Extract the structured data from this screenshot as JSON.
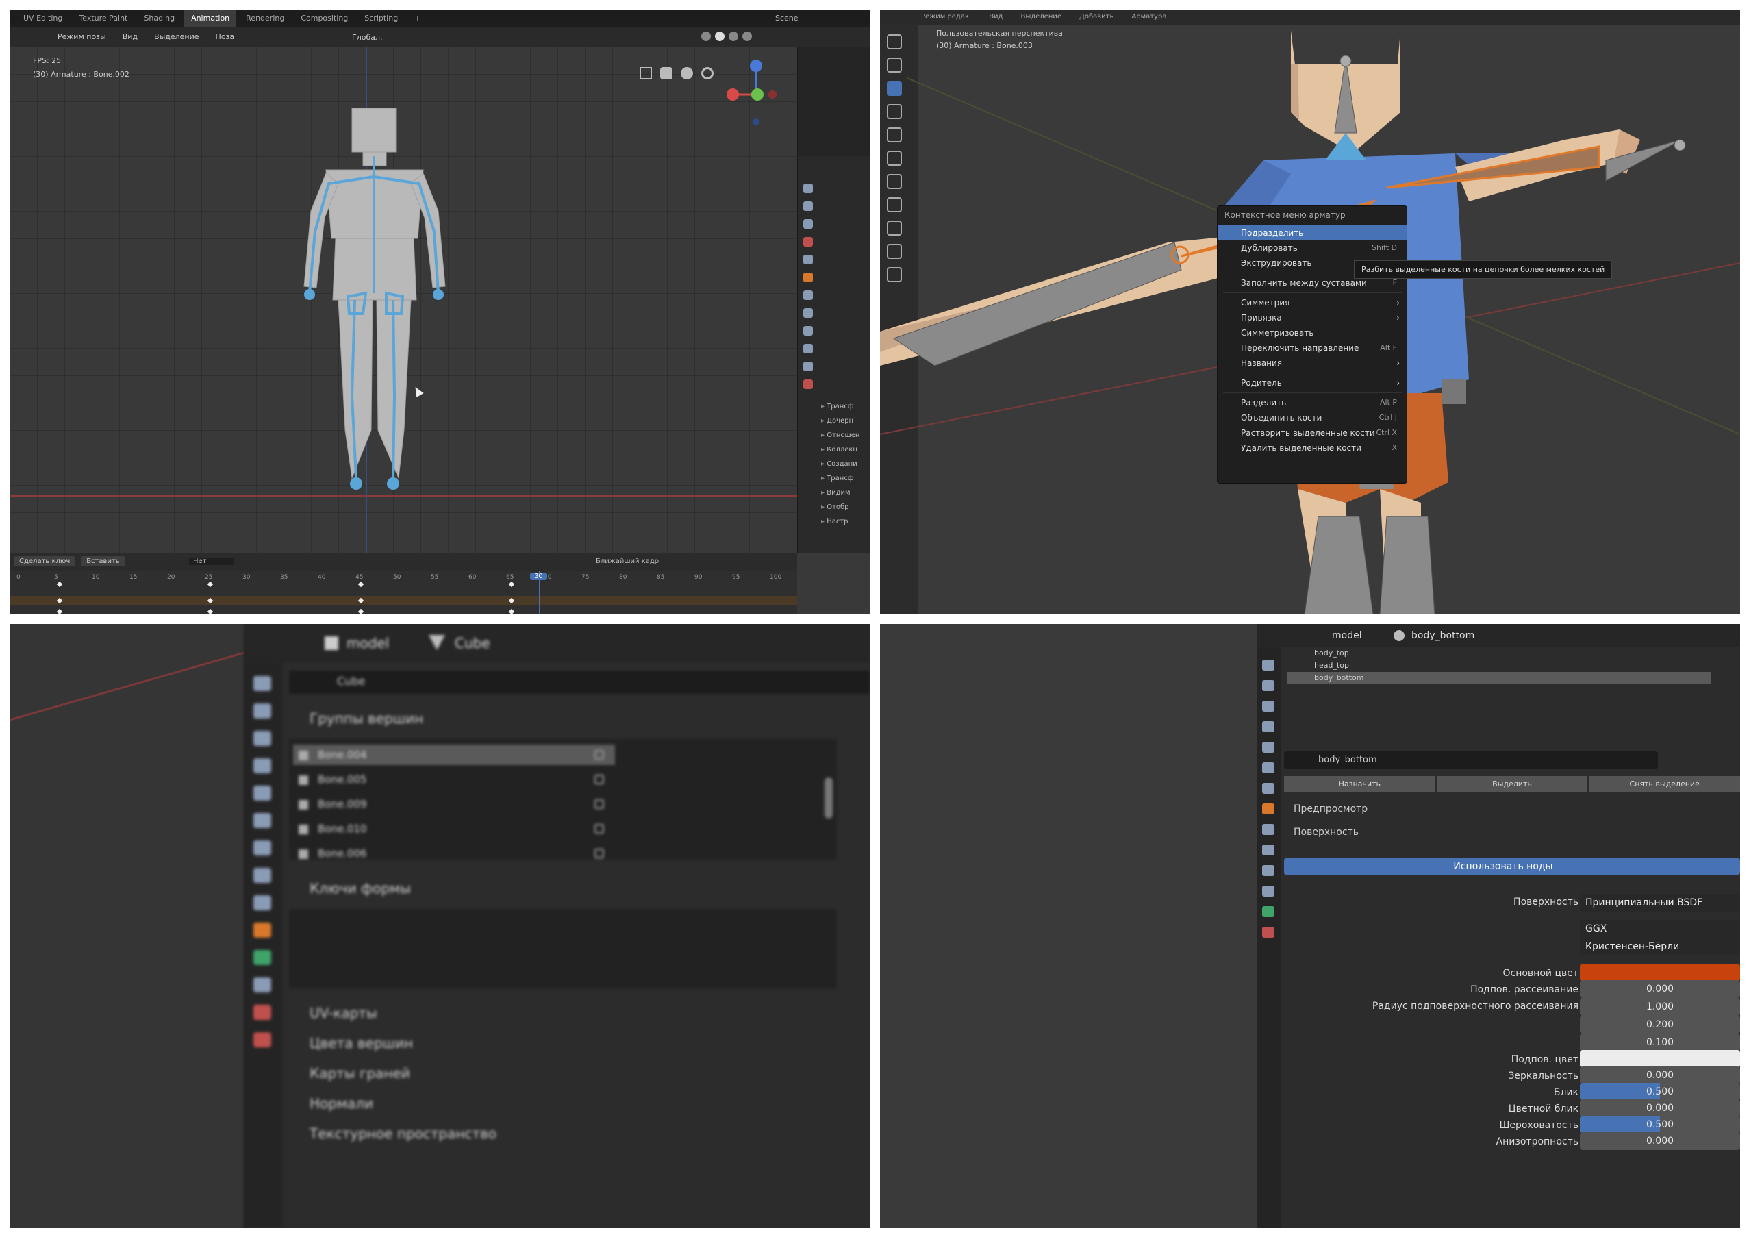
{
  "anim": {
    "workspace_tabs": [
      "UV Editing",
      "Texture Paint",
      "Shading",
      "Animation",
      "Rendering",
      "Compositing",
      "Scripting",
      "+"
    ],
    "scene_label": "Scene",
    "header_menus": [
      "Режим позы",
      "Вид",
      "Выделение",
      "Поза"
    ],
    "transform_label": "Глобал.",
    "info_line1": "FPS: 25",
    "info_line2": "(30) Armature : Bone.002",
    "props_items": [
      "Трансф",
      "Дочерн",
      "Отношен",
      "Коллекц",
      "Создани",
      "Трансф",
      "Видим",
      "Отобр",
      "Настр"
    ],
    "timeline_buttons": [
      "Сделать ключ",
      "Вставить"
    ],
    "timeline_field": "Нет",
    "interp_label": "Ближайший кадр",
    "frame_ticks": [
      "0",
      "5",
      "10",
      "15",
      "20",
      "25",
      "30",
      "35",
      "40",
      "45",
      "50",
      "55",
      "60",
      "65",
      "70",
      "75",
      "80",
      "85",
      "90",
      "95",
      "100"
    ],
    "current_frame": "30"
  },
  "ctx": {
    "header_menus": [
      "Режим редак.",
      "Вид",
      "Выделение",
      "Добавить",
      "Арматура"
    ],
    "viewport_line1": "Пользовательская перспектива",
    "viewport_line2": "(30) Armature : Bone.003",
    "menu_title": "Контекстное меню арматур",
    "menu_items": [
      {
        "label": "Подразделить",
        "shortcut": "",
        "sub": false,
        "highlight": true,
        "sep": false
      },
      {
        "label": "Дублировать",
        "shortcut": "Shift D",
        "sub": false,
        "highlight": false,
        "sep": false
      },
      {
        "label": "Экструдировать",
        "shortcut": "E",
        "sub": false,
        "highlight": false,
        "sep": true
      },
      {
        "label": "Заполнить между суставами",
        "shortcut": "F",
        "sub": false,
        "highlight": false,
        "sep": true
      },
      {
        "label": "Симметрия",
        "shortcut": "",
        "sub": true,
        "highlight": false,
        "sep": false
      },
      {
        "label": "Привязка",
        "shortcut": "",
        "sub": true,
        "highlight": false,
        "sep": false
      },
      {
        "label": "Симметризовать",
        "shortcut": "",
        "sub": false,
        "highlight": false,
        "sep": false
      },
      {
        "label": "Переключить направление",
        "shortcut": "Alt F",
        "sub": false,
        "highlight": false,
        "sep": false
      },
      {
        "label": "Названия",
        "shortcut": "",
        "sub": true,
        "highlight": false,
        "sep": true
      },
      {
        "label": "Родитель",
        "shortcut": "",
        "sub": true,
        "highlight": false,
        "sep": true
      },
      {
        "label": "Разделить",
        "shortcut": "Alt P",
        "sub": false,
        "highlight": false,
        "sep": false
      },
      {
        "label": "Объединить кости",
        "shortcut": "Ctrl J",
        "sub": false,
        "highlight": false,
        "sep": false
      },
      {
        "label": "Растворить выделенные кости",
        "shortcut": "Ctrl X",
        "sub": false,
        "highlight": false,
        "sep": false
      },
      {
        "label": "Удалить выделенные кости",
        "shortcut": "X",
        "sub": false,
        "highlight": false,
        "sep": false
      }
    ],
    "tooltip": "Разбить выделенные кости на цепочки более мелких костей"
  },
  "vgroups": {
    "breadcrumb_object": "model",
    "breadcrumb_mesh": "Cube",
    "mesh_name": "Cube",
    "section_vgroups": "Группы вершин",
    "groups": [
      "Bone.004",
      "Bone.005",
      "Bone.009",
      "Bone.010",
      "Bone.006"
    ],
    "section_shapekeys": "Ключи формы",
    "more_sections": [
      "UV-карты",
      "Цвета вершин",
      "Карты граней",
      "Нормали",
      "Текстурное пространство"
    ]
  },
  "material": {
    "breadcrumb_object": "model",
    "breadcrumb_material": "body_bottom",
    "slots": [
      "body_top",
      "head_top",
      "body_bottom"
    ],
    "material_name": "body_bottom",
    "buttons": [
      "Назначить",
      "Выделить",
      "Снять выделение"
    ],
    "sections": [
      "Предпросмотр",
      "Поверхность"
    ],
    "use_nodes": "Использовать ноды",
    "surface_label": "Поверхность",
    "surface_value": "Принципиальный BSDF",
    "ggx": "GGX",
    "burley": "Кристенсен-Бёрли",
    "base_color_label": "Основной цвет",
    "base_color": "#c8420c",
    "subsurface_label": "Подпов. рассеивание",
    "subsurface_value": "0.000",
    "radius_label": "Радиус подповерхностного рассеивания",
    "radius_values": [
      "1.000",
      "0.200",
      "0.100"
    ],
    "subsurface_color_label": "Подпов. цвет",
    "subsurface_color": "#ececec",
    "metallic_label": "Зеркальность",
    "metallic_value": "0.000",
    "specular_label": "Блик",
    "specular_value": "0.500",
    "specular_tint_label": "Цветной блик",
    "specular_tint_value": "0.000",
    "roughness_label": "Шероховатость",
    "roughness_value": "0.500",
    "anisotropic_label": "Анизотропность",
    "anisotropic_value": "0.000"
  },
  "colors": {
    "accent_blue": "#4772b3",
    "bone_blue": "#5aa6d8",
    "skin": "#e2be97",
    "shirt": "#5b84cf",
    "pants": "#c9652a",
    "panel_dark": "#232323"
  }
}
